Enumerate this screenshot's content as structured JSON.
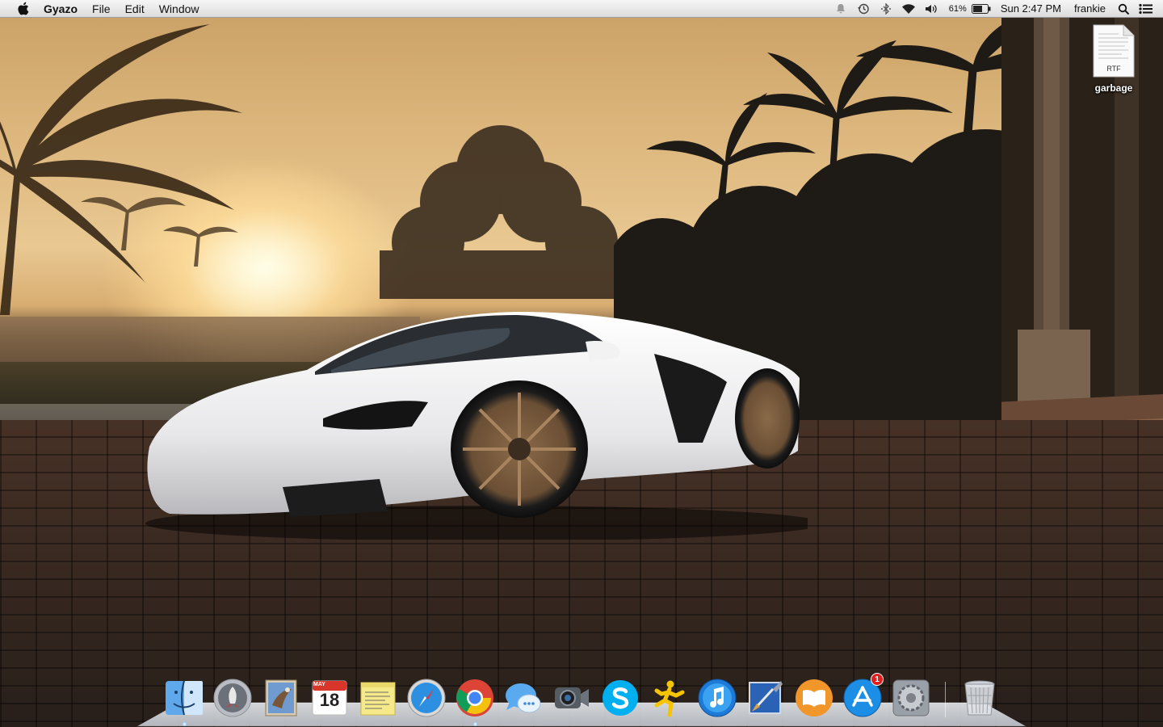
{
  "menubar": {
    "apple_icon": "apple-icon",
    "app_name": "Gyazo",
    "menus": [
      "File",
      "Edit",
      "Window"
    ],
    "status": {
      "notification_icon": "notification-center-icon",
      "time_machine_icon": "time-machine-icon",
      "bluetooth_icon": "bluetooth-icon",
      "wifi_icon": "wifi-icon",
      "volume_icon": "volume-icon",
      "battery_percent": "61%",
      "battery_icon": "battery-icon",
      "clock": "Sun 2:47 PM",
      "user": "frankie",
      "spotlight_icon": "spotlight-search-icon",
      "list_icon": "notification-list-icon"
    }
  },
  "desktop": {
    "file": {
      "name": "garbage",
      "type": "RTF"
    }
  },
  "dock": {
    "items": [
      {
        "name": "finder",
        "icon": "finder-icon",
        "running": true
      },
      {
        "name": "launchpad",
        "icon": "launchpad-icon"
      },
      {
        "name": "mail",
        "icon": "mail-icon"
      },
      {
        "name": "calendar",
        "icon": "calendar-icon",
        "month": "MAY",
        "day": "18"
      },
      {
        "name": "stickies",
        "icon": "stickies-icon"
      },
      {
        "name": "safari",
        "icon": "safari-icon"
      },
      {
        "name": "chrome",
        "icon": "chrome-icon",
        "running": true
      },
      {
        "name": "messages",
        "icon": "messages-icon"
      },
      {
        "name": "facetime",
        "icon": "facetime-icon"
      },
      {
        "name": "skype",
        "icon": "skype-icon"
      },
      {
        "name": "aim",
        "icon": "aim-running-man-icon"
      },
      {
        "name": "itunes",
        "icon": "itunes-icon"
      },
      {
        "name": "xcode",
        "icon": "xcode-icon"
      },
      {
        "name": "ibooks",
        "icon": "ibooks-icon"
      },
      {
        "name": "app-store",
        "icon": "app-store-icon",
        "badge": "1"
      },
      {
        "name": "system-preferences",
        "icon": "system-preferences-icon"
      },
      {
        "name": "trash",
        "icon": "trash-icon"
      }
    ]
  },
  "colors": {
    "menubar_top": "#f6f6f6",
    "menubar_bottom": "#dcdcdc",
    "badge_red": "#e0201f",
    "sky": "#e9c892"
  }
}
